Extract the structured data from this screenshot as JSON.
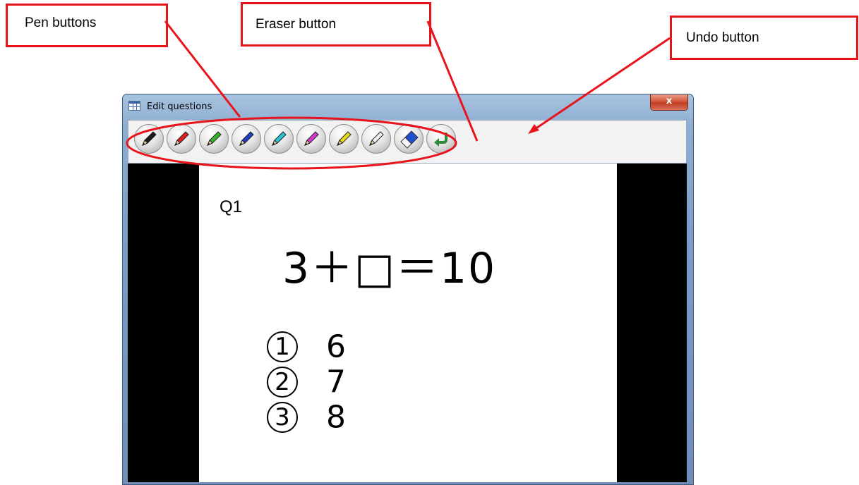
{
  "callouts": {
    "pen": "Pen buttons",
    "eraser": "Eraser button",
    "undo": "Undo button"
  },
  "window": {
    "title": "Edit questions",
    "close_label": "x"
  },
  "toolbar": {
    "pens": [
      {
        "name": "black-pen",
        "color": "#1a1a1a"
      },
      {
        "name": "red-pen",
        "color": "#e0201a"
      },
      {
        "name": "green-pen",
        "color": "#35b52b"
      },
      {
        "name": "blue-pen",
        "color": "#1b3fbf"
      },
      {
        "name": "cyan-pen",
        "color": "#27c3cf"
      },
      {
        "name": "magenta-pen",
        "color": "#d33ad1"
      },
      {
        "name": "yellow-pen",
        "color": "#e5dc17"
      },
      {
        "name": "white-pen",
        "color": "#f4f4f4"
      }
    ],
    "eraser_icon": "eraser-icon",
    "undo_icon": "undo-arrow-icon"
  },
  "sheet": {
    "question_label": "Q1",
    "equation": "3＋□＝10",
    "choices": [
      {
        "num": "1",
        "value": "6"
      },
      {
        "num": "2",
        "value": "7"
      },
      {
        "num": "3",
        "value": "8"
      }
    ]
  },
  "colors": {
    "callout_border": "#e8141c",
    "window_frame": "#7b9dc6",
    "close_button": "#c13f23"
  }
}
